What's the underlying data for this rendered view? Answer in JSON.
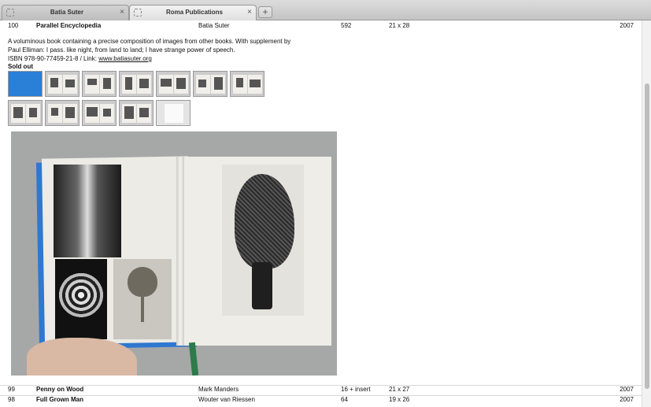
{
  "browser": {
    "tabs": [
      {
        "title": "Batia Suter",
        "active": false
      },
      {
        "title": "Roma Publications",
        "active": true
      }
    ],
    "close_glyph": "×",
    "new_tab_glyph": "+"
  },
  "entries": [
    {
      "number": "100",
      "title": "Parallel Encyclopedia",
      "artist": "Batia Suter",
      "pages": "592",
      "size": "21 x 28",
      "year": "2007"
    },
    {
      "number": "99",
      "title": "Penny on Wood",
      "artist": "Mark Manders",
      "pages": "16 + insert",
      "size": "21 x 27",
      "year": "2007"
    },
    {
      "number": "98",
      "title": "Full Grown Man",
      "artist": "Wouter van Riessen",
      "pages": "64",
      "size": "19 x 26",
      "year": "2007"
    }
  ],
  "detail": {
    "description_line1": "A voluminous book containing a precise composition of images from other books. With supplement by",
    "description_line2": "Paul Elliman: I pass. like night, from land to land; I have strange power of speech.",
    "isbn_prefix": "ISBN 978-90-77459-21-8 / Link: ",
    "link_text": "www.batiasuter.org",
    "status": "Sold out",
    "thumbnail_count": 12
  },
  "colors": {
    "book_cover": "#2f78d0",
    "ribbon": "#2e7a4a"
  }
}
